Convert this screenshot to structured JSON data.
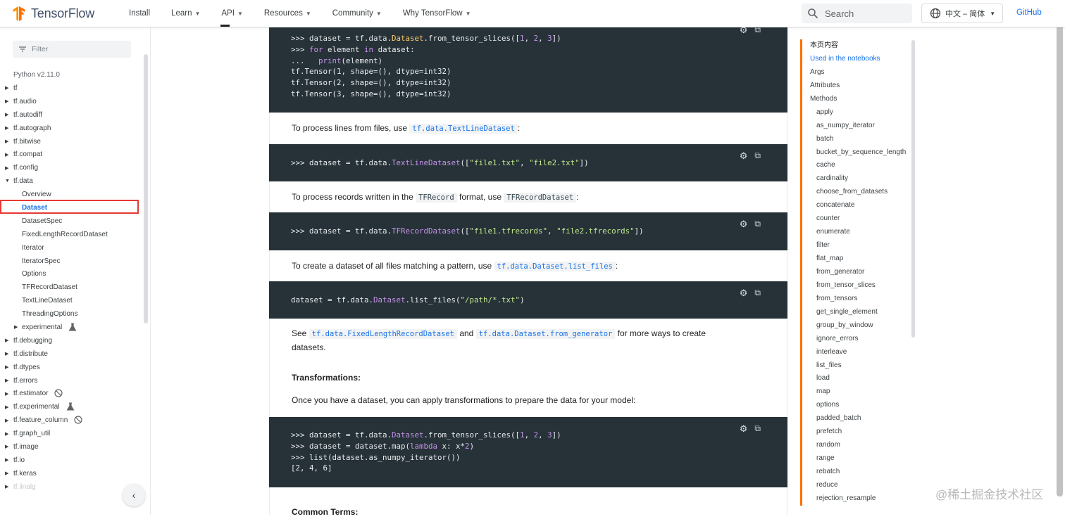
{
  "header": {
    "logo_text": "TensorFlow",
    "nav": [
      {
        "label": "Install",
        "dropdown": false,
        "active": false
      },
      {
        "label": "Learn",
        "dropdown": true,
        "active": false
      },
      {
        "label": "API",
        "dropdown": true,
        "active": true
      },
      {
        "label": "Resources",
        "dropdown": true,
        "active": false
      },
      {
        "label": "Community",
        "dropdown": true,
        "active": false
      },
      {
        "label": "Why TensorFlow",
        "dropdown": true,
        "active": false
      }
    ],
    "search_placeholder": "Search",
    "language": "中文 – 简体",
    "github": "GitHub",
    "accent": "#ff6f00"
  },
  "sidebar": {
    "filter_placeholder": "Filter",
    "version": "Python v2.11.0",
    "items": [
      {
        "label": "tf",
        "arrow": "▸",
        "child": false
      },
      {
        "label": "tf.audio",
        "arrow": "▸",
        "child": false
      },
      {
        "label": "tf.autodiff",
        "arrow": "▸",
        "child": false
      },
      {
        "label": "tf.autograph",
        "arrow": "▸",
        "child": false
      },
      {
        "label": "tf.bitwise",
        "arrow": "▸",
        "child": false
      },
      {
        "label": "tf.compat",
        "arrow": "▸",
        "child": false
      },
      {
        "label": "tf.config",
        "arrow": "▸",
        "child": false
      },
      {
        "label": "tf.data",
        "arrow": "▾",
        "child": false
      },
      {
        "label": "Overview",
        "arrow": "",
        "child": true
      },
      {
        "label": "Dataset",
        "arrow": "",
        "child": true,
        "selected": true
      },
      {
        "label": "DatasetSpec",
        "arrow": "",
        "child": true
      },
      {
        "label": "FixedLengthRecordDataset",
        "arrow": "",
        "child": true
      },
      {
        "label": "Iterator",
        "arrow": "",
        "child": true
      },
      {
        "label": "IteratorSpec",
        "arrow": "",
        "child": true
      },
      {
        "label": "Options",
        "arrow": "",
        "child": true
      },
      {
        "label": "TFRecordDataset",
        "arrow": "",
        "child": true
      },
      {
        "label": "TextLineDataset",
        "arrow": "",
        "child": true
      },
      {
        "label": "ThreadingOptions",
        "arrow": "",
        "child": true
      },
      {
        "label": "experimental",
        "arrow": "▸",
        "child": true,
        "icon": "flask-icon"
      },
      {
        "label": "tf.debugging",
        "arrow": "▸",
        "child": false
      },
      {
        "label": "tf.distribute",
        "arrow": "▸",
        "child": false
      },
      {
        "label": "tf.dtypes",
        "arrow": "▸",
        "child": false
      },
      {
        "label": "tf.errors",
        "arrow": "▸",
        "child": false
      },
      {
        "label": "tf.estimator",
        "arrow": "▸",
        "child": false,
        "icon": "deprecated-icon"
      },
      {
        "label": "tf.experimental",
        "arrow": "▸",
        "child": false,
        "icon": "flask-icon"
      },
      {
        "label": "tf.feature_column",
        "arrow": "▸",
        "child": false,
        "icon": "deprecated-icon"
      },
      {
        "label": "tf.graph_util",
        "arrow": "▸",
        "child": false
      },
      {
        "label": "tf.image",
        "arrow": "▸",
        "child": false
      },
      {
        "label": "tf.io",
        "arrow": "▸",
        "child": false
      },
      {
        "label": "tf.keras",
        "arrow": "▸",
        "child": false
      },
      {
        "label": "tf.linalg",
        "arrow": "▸",
        "child": false,
        "faded": true
      }
    ]
  },
  "content": {
    "p1_before": "To process lines from files, use ",
    "p1_code": "tf.data.TextLineDataset",
    "p1_after": ":",
    "p2_before": "To process records written in the ",
    "p2_code1": "TFRecord",
    "p2_mid": " format, use ",
    "p2_code2": "TFRecordDataset",
    "p2_after": ":",
    "p3_before": "To create a dataset of all files matching a pattern, use ",
    "p3_code": "tf.data.Dataset.list_files",
    "p3_after": ":",
    "p4_before": "See ",
    "p4_code1": "tf.data.FixedLengthRecordDataset",
    "p4_mid": " and ",
    "p4_code2": "tf.data.Dataset.from_generator",
    "p4_after": " for more ways to create datasets.",
    "h_transform": "Transformations:",
    "p5": "Once you have a dataset, you can apply transformations to prepare the data for your model:",
    "h_common": "Common Terms:"
  },
  "toc": {
    "items": [
      {
        "label": "本页内容",
        "type": "head"
      },
      {
        "label": "Used in the notebooks",
        "type": "active"
      },
      {
        "label": "Args",
        "type": "top"
      },
      {
        "label": "Attributes",
        "type": "top"
      },
      {
        "label": "Methods",
        "type": "top"
      },
      {
        "label": "apply",
        "type": "sub"
      },
      {
        "label": "as_numpy_iterator",
        "type": "sub"
      },
      {
        "label": "batch",
        "type": "sub"
      },
      {
        "label": "bucket_by_sequence_length",
        "type": "sub"
      },
      {
        "label": "cache",
        "type": "sub"
      },
      {
        "label": "cardinality",
        "type": "sub"
      },
      {
        "label": "choose_from_datasets",
        "type": "sub"
      },
      {
        "label": "concatenate",
        "type": "sub"
      },
      {
        "label": "counter",
        "type": "sub"
      },
      {
        "label": "enumerate",
        "type": "sub"
      },
      {
        "label": "filter",
        "type": "sub"
      },
      {
        "label": "flat_map",
        "type": "sub"
      },
      {
        "label": "from_generator",
        "type": "sub"
      },
      {
        "label": "from_tensor_slices",
        "type": "sub"
      },
      {
        "label": "from_tensors",
        "type": "sub"
      },
      {
        "label": "get_single_element",
        "type": "sub"
      },
      {
        "label": "group_by_window",
        "type": "sub"
      },
      {
        "label": "ignore_errors",
        "type": "sub"
      },
      {
        "label": "interleave",
        "type": "sub"
      },
      {
        "label": "list_files",
        "type": "sub"
      },
      {
        "label": "load",
        "type": "sub"
      },
      {
        "label": "map",
        "type": "sub"
      },
      {
        "label": "options",
        "type": "sub"
      },
      {
        "label": "padded_batch",
        "type": "sub"
      },
      {
        "label": "prefetch",
        "type": "sub"
      },
      {
        "label": "random",
        "type": "sub"
      },
      {
        "label": "range",
        "type": "sub"
      },
      {
        "label": "rebatch",
        "type": "sub"
      },
      {
        "label": "reduce",
        "type": "sub"
      },
      {
        "label": "rejection_resample",
        "type": "sub"
      }
    ]
  },
  "watermark": "@稀土掘金技术社区"
}
